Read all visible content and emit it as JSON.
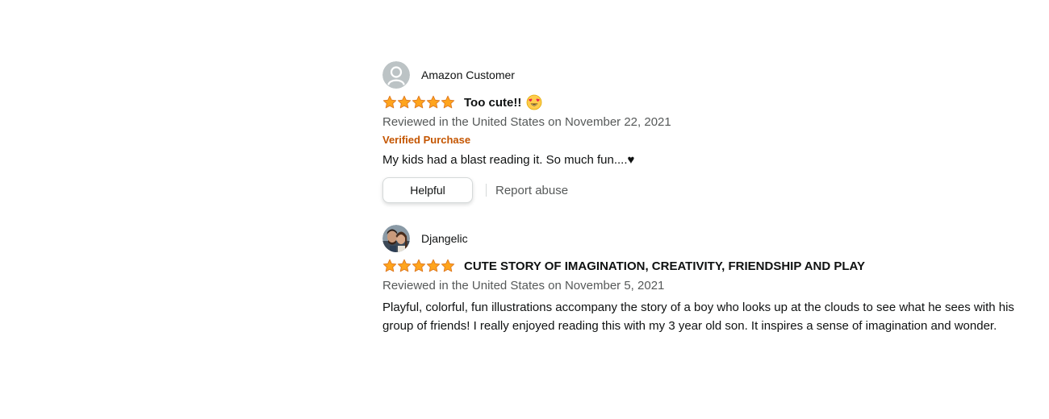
{
  "reviews": [
    {
      "profile_name": "Amazon Customer",
      "avatar_icon": "default-user-avatar-icon",
      "rating": 5,
      "max_rating": 5,
      "title": "Too cute!!",
      "title_emoji": "smiling-face-with-heart-eyes",
      "date": "Reviewed in the United States on November 22, 2021",
      "verified": "Verified Purchase",
      "body": "My kids had a blast reading it. So much fun....♥",
      "helpful_label": "Helpful",
      "report_label": "Report abuse"
    },
    {
      "profile_name": "Djangelic",
      "avatar_icon": "photo-avatar",
      "rating": 5,
      "max_rating": 5,
      "title": "CUTE STORY OF IMAGINATION, CREATIVITY, FRIENDSHIP AND PLAY",
      "date": "Reviewed in the United States on November 5, 2021",
      "body": "Playful, colorful, fun illustrations accompany the story of a boy who looks up at the clouds to see what he sees with his group of friends! I really enjoyed reading this with my 3 year old son. It inspires a sense of imagination and wonder."
    }
  ],
  "colors": {
    "star": "#ffa41c",
    "star_stroke": "#de7921",
    "verified": "#c45500",
    "secondary_text": "#565959"
  }
}
